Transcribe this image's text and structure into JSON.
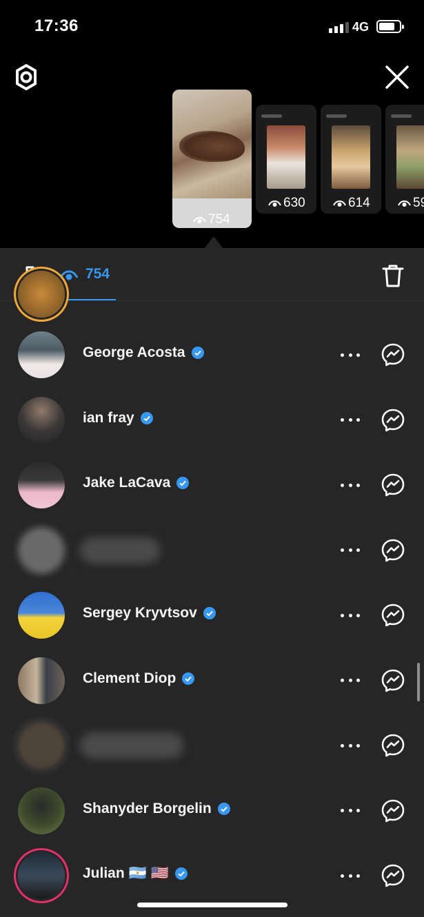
{
  "status_bar": {
    "time": "17:36",
    "network": "4G"
  },
  "stories": [
    {
      "views": "754",
      "active": true
    },
    {
      "views": "630",
      "active": false
    },
    {
      "views": "614",
      "active": false
    },
    {
      "views": "59",
      "active": false
    }
  ],
  "sheet": {
    "views_count": "754",
    "viewers": [
      {
        "name": "",
        "verified": false,
        "blurred": false,
        "partial": true
      },
      {
        "name": "George Acosta",
        "verified": true,
        "blurred": false
      },
      {
        "name": "ian fray",
        "verified": true,
        "blurred": false
      },
      {
        "name": "Jake LaCava",
        "verified": true,
        "blurred": false
      },
      {
        "name": "",
        "verified": false,
        "blurred": true
      },
      {
        "name": "Sergey Kryvtsov",
        "verified": true,
        "blurred": false
      },
      {
        "name": "Clement Diop",
        "verified": true,
        "blurred": false
      },
      {
        "name": "",
        "verified": false,
        "blurred": true
      },
      {
        "name": "Shanyder Borgelin",
        "verified": true,
        "blurred": false
      },
      {
        "name": "Julian 🇦🇷 🇺🇸",
        "verified": true,
        "blurred": false,
        "story_ring": true
      }
    ]
  },
  "colors": {
    "accent": "#3897f0",
    "sheet_bg": "#262626",
    "background": "#000000",
    "story_ring": "#e1306c"
  },
  "icons": {
    "settings": "gear-icon",
    "close": "close-icon",
    "insights": "bar-chart-icon",
    "views": "eye-icon",
    "delete": "trash-icon",
    "more": "more-horizontal-icon",
    "message": "messenger-icon",
    "verified": "verified-badge-icon"
  }
}
